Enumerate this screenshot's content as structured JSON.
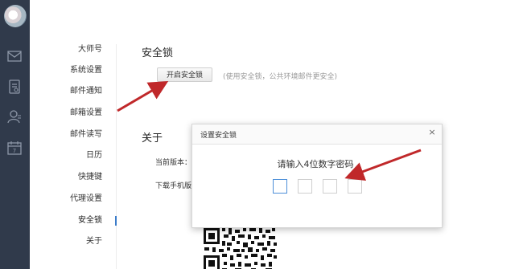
{
  "nav": {
    "items": [
      {
        "label": "大师号"
      },
      {
        "label": "系统设置"
      },
      {
        "label": "邮件通知"
      },
      {
        "label": "邮箱设置"
      },
      {
        "label": "邮件读写"
      },
      {
        "label": "日历"
      },
      {
        "label": "快捷键"
      },
      {
        "label": "代理设置"
      },
      {
        "label": "安全锁"
      },
      {
        "label": "关于"
      }
    ]
  },
  "security": {
    "title": "安全锁",
    "button_label": "开启安全锁",
    "hint": "(使用安全锁，公共环境邮件更安全)"
  },
  "about": {
    "title": "关于",
    "version_label": "当前版本：",
    "download_label": "下载手机版"
  },
  "dialog": {
    "title": "设置安全锁",
    "close_symbol": "×",
    "prompt": "请输入4位数字密码",
    "pin_count": 4
  },
  "colors": {
    "sidebar": "#303a4b",
    "accent": "#3b7cc9",
    "arrow": "#c0282a"
  },
  "icons": [
    "mail-icon",
    "notes-icon",
    "contacts-icon",
    "calendar-icon"
  ]
}
